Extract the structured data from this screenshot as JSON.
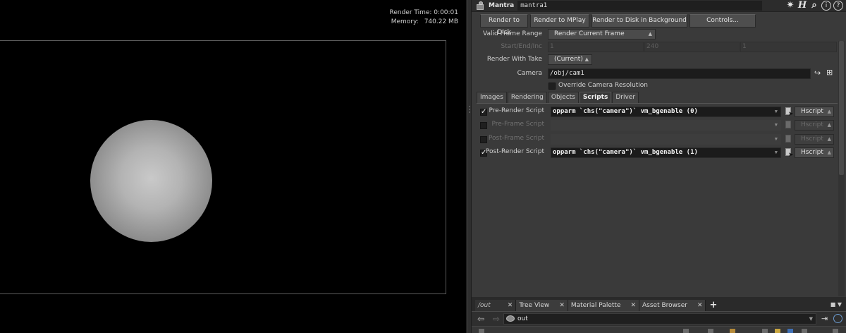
{
  "viewport": {
    "render_time_label": "Render Time: 0:00:01",
    "memory_label": "Memory:",
    "memory_value": "740.22 MB"
  },
  "node": {
    "type": "Mantra",
    "name": "mantra1",
    "header_icons": [
      "gear-icon",
      "houdini-h-icon",
      "search-icon",
      "info-icon",
      "help-icon"
    ]
  },
  "buttons": {
    "render_to_disk": "Render to Disk",
    "render_to_mplay": "Render to MPlay",
    "render_bg": "Render to Disk in Background",
    "controls": "Controls..."
  },
  "params": {
    "valid_frame_range": {
      "label": "Valid Frame Range",
      "value": "Render Current Frame"
    },
    "start_end_inc": {
      "label": "Start/End/Inc",
      "values": [
        "1",
        "240",
        "1"
      ]
    },
    "render_with_take": {
      "label": "Render With Take",
      "value": "(Current)"
    },
    "camera": {
      "label": "Camera",
      "value": "/obj/cam1"
    },
    "override_res": {
      "label": "Override Camera Resolution",
      "checked": false
    }
  },
  "tabs": [
    "Images",
    "Rendering",
    "Objects",
    "Scripts",
    "Driver"
  ],
  "active_tab": "Scripts",
  "scripts": [
    {
      "label": "Pre-Render Script",
      "value": "opparm `chs(\"camera\")` vm_bgenable (0)",
      "enabled": true,
      "lang": "Hscript"
    },
    {
      "label": "Pre-Frame Script",
      "value": "",
      "enabled": false,
      "lang": "Hscript"
    },
    {
      "label": "Post-Frame Script",
      "value": "",
      "enabled": false,
      "lang": "Hscript"
    },
    {
      "label": "Post-Render Script",
      "value": "opparm `chs(\"camera\")` vm_bgenable (1)",
      "enabled": true,
      "lang": "Hscript"
    }
  ],
  "network": {
    "tabs": [
      "/out",
      "Tree View",
      "Material Palette",
      "Asset Browser"
    ],
    "path": "out"
  }
}
